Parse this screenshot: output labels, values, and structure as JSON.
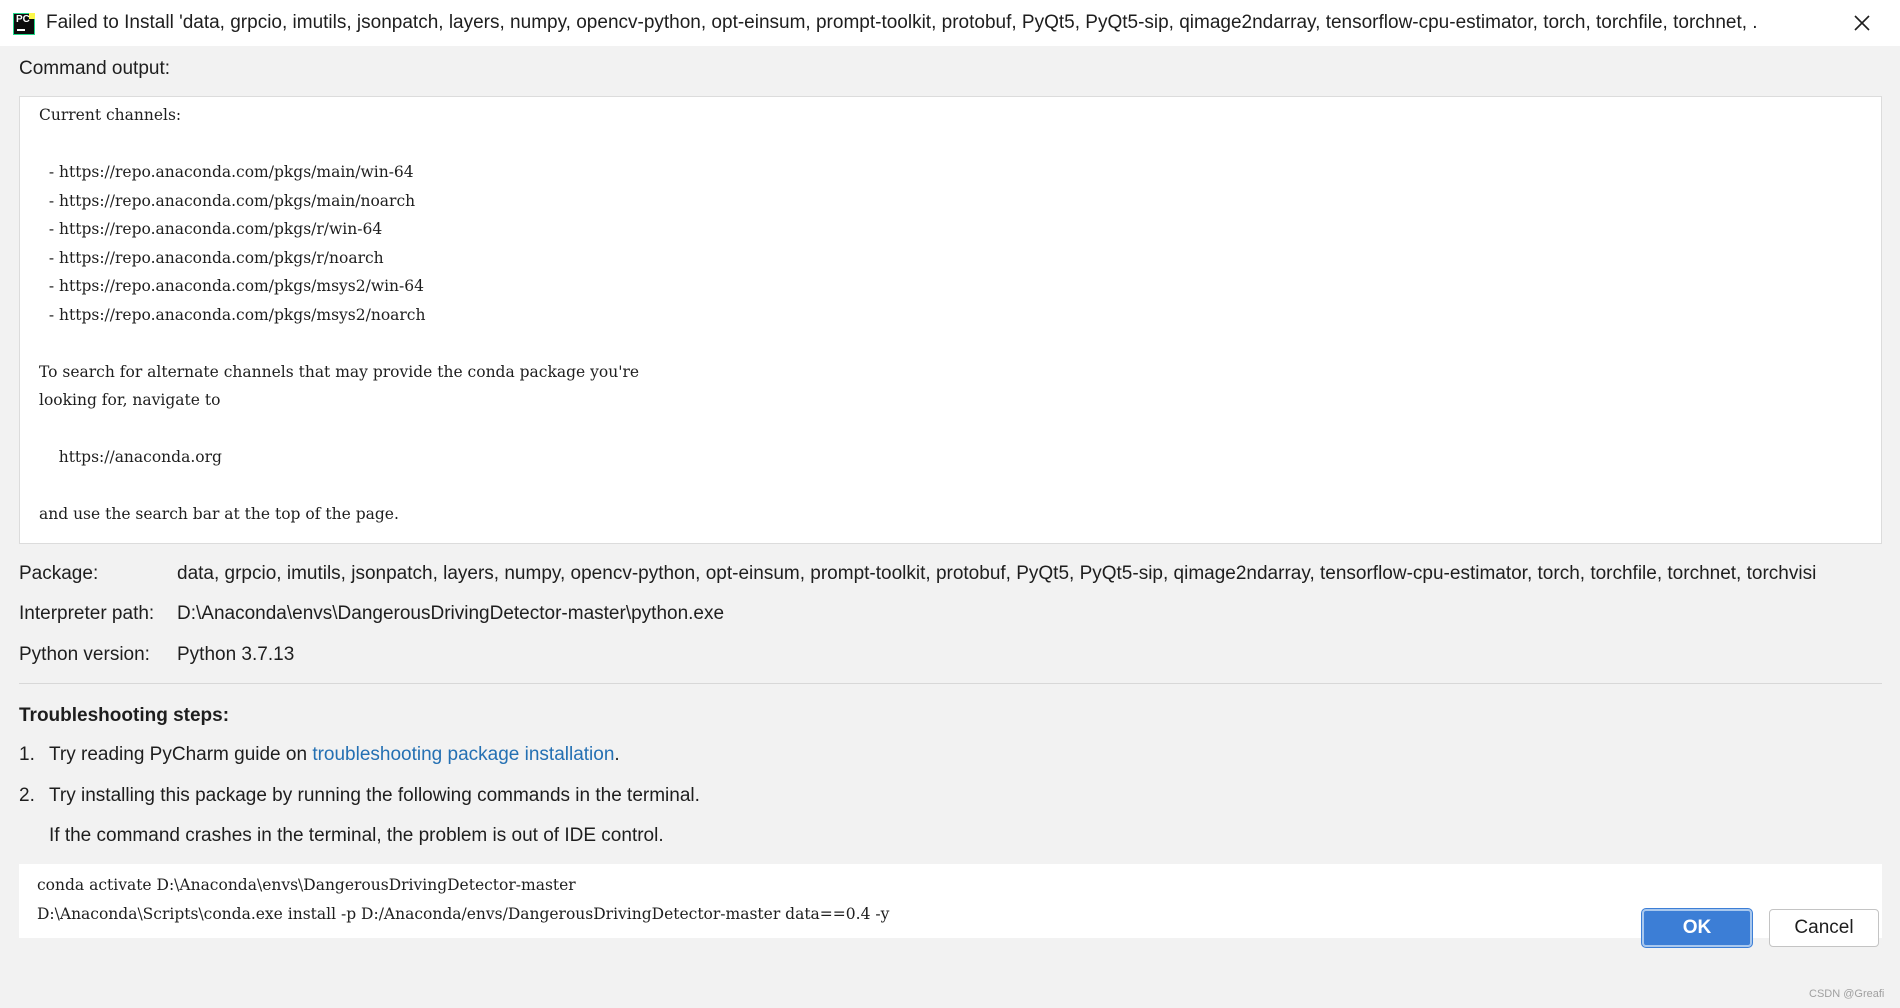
{
  "dialog": {
    "title": "Failed to Install 'data, grpcio, imutils, jsonpatch, layers, numpy, opencv-python, opt-einsum, prompt-toolkit, protobuf, PyQt5, PyQt5-sip, qimage2ndarray, tensorflow-cpu-estimator, torch, torchfile, torchnet, .",
    "app_icon": "pycharm-logo-icon",
    "close_icon": "close-icon"
  },
  "output": {
    "label": "Command output:",
    "text": "Current channels:\n\n  - https://repo.anaconda.com/pkgs/main/win-64\n  - https://repo.anaconda.com/pkgs/main/noarch\n  - https://repo.anaconda.com/pkgs/r/win-64\n  - https://repo.anaconda.com/pkgs/r/noarch\n  - https://repo.anaconda.com/pkgs/msys2/win-64\n  - https://repo.anaconda.com/pkgs/msys2/noarch\n\nTo search for alternate channels that may provide the conda package you're\nlooking for, navigate to\n\n    https://anaconda.org\n\nand use the search bar at the top of the page."
  },
  "info": {
    "package_label": "Package:",
    "package_value": "data, grpcio, imutils, jsonpatch, layers, numpy, opencv-python, opt-einsum, prompt-toolkit, protobuf, PyQt5, PyQt5-sip, qimage2ndarray, tensorflow-cpu-estimator, torch, torchfile, torchnet, torchvisi",
    "interpreter_label": "Interpreter path:",
    "interpreter_value": "D:\\Anaconda\\envs\\DangerousDrivingDetector-master\\python.exe",
    "python_label": "Python version:",
    "python_value": "Python 3.7.13"
  },
  "troubleshooting": {
    "heading": "Troubleshooting steps:",
    "step1_num": "1.",
    "step1_prefix": "Try reading PyCharm guide on ",
    "step1_link": "troubleshooting package installation",
    "step1_suffix": ".",
    "step2_num": "2.",
    "step2_text": "Try installing this package by running the following commands in the terminal.",
    "step2_note": "If the command crashes in the terminal, the problem is out of IDE control.",
    "commands": "conda activate D:\\Anaconda\\envs\\DangerousDrivingDetector-master\nD:\\Anaconda\\Scripts\\conda.exe install -p D:/Anaconda/envs/DangerousDrivingDetector-master data==0.4 -y"
  },
  "buttons": {
    "ok": "OK",
    "cancel": "Cancel"
  },
  "watermark": "CSDN @Greafi",
  "colors": {
    "link": "#2470b3",
    "primary_button": "#3c7ed6"
  }
}
